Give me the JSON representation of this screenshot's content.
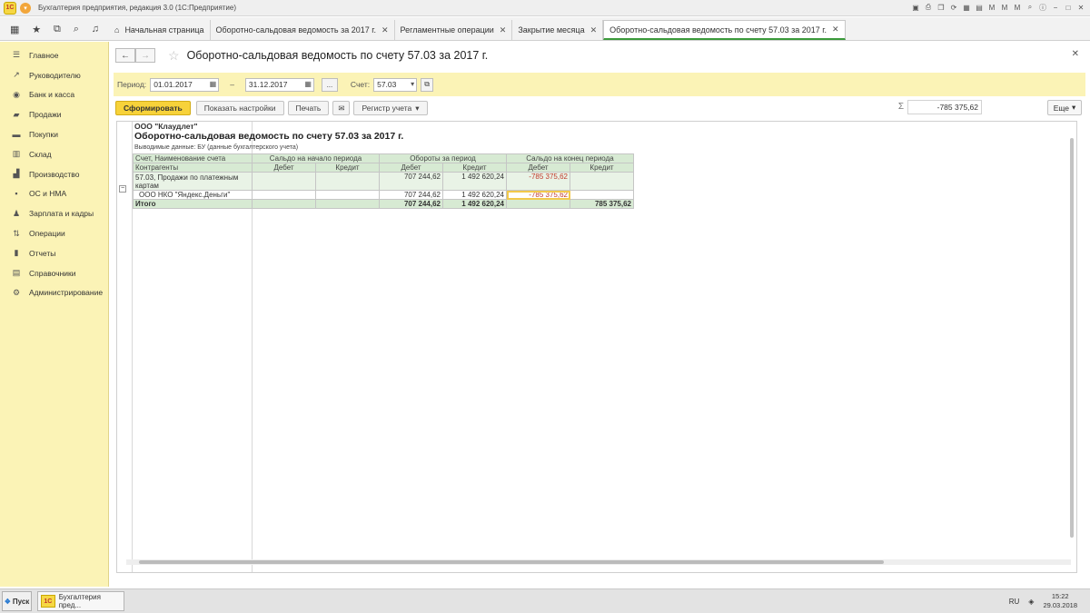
{
  "app": {
    "title": "Бухгалтерия предприятия, редакция 3.0 (1С:Предприятие)",
    "logo_text": "1С"
  },
  "tabs": [
    {
      "label": "Начальная страница",
      "closable": false
    },
    {
      "label": "Оборотно-сальдовая ведомость за 2017 г.",
      "closable": true
    },
    {
      "label": "Регламентные операции",
      "closable": true
    },
    {
      "label": "Закрытие месяца",
      "closable": true
    },
    {
      "label": "Оборотно-сальдовая ведомость по счету 57.03 за 2017 г.",
      "closable": true,
      "active": true
    }
  ],
  "sidebar": {
    "items": [
      {
        "label": "Главное",
        "icon": "list-icon"
      },
      {
        "label": "Руководителю",
        "icon": "trend-icon"
      },
      {
        "label": "Банк и касса",
        "icon": "bank-icon"
      },
      {
        "label": "Продажи",
        "icon": "cart-icon"
      },
      {
        "label": "Покупки",
        "icon": "truck-icon"
      },
      {
        "label": "Склад",
        "icon": "warehouse-icon"
      },
      {
        "label": "Производство",
        "icon": "factory-icon"
      },
      {
        "label": "ОС и НМА",
        "icon": "assets-icon"
      },
      {
        "label": "Зарплата и кадры",
        "icon": "people-icon"
      },
      {
        "label": "Операции",
        "icon": "operations-icon"
      },
      {
        "label": "Отчеты",
        "icon": "chart-icon"
      },
      {
        "label": "Справочники",
        "icon": "book-icon"
      },
      {
        "label": "Администрирование",
        "icon": "gear-icon"
      }
    ]
  },
  "form": {
    "title": "Оборотно-сальдовая ведомость по счету 57.03 за 2017 г.",
    "period_label": "Период:",
    "period_from": "01.01.2017",
    "period_dash": "–",
    "period_to": "31.12.2017",
    "ellipsis": "...",
    "account_label": "Счет:",
    "account_value": "57.03"
  },
  "commands": {
    "generate": "Сформировать",
    "show_settings": "Показать настройки",
    "print": "Печать",
    "register": "Регистр учета",
    "sigma": "Σ",
    "sum_value": "-785 375,62",
    "more": "Еще"
  },
  "report": {
    "org": "ООО \"Клаудлет\"",
    "title": "Оборотно-сальдовая ведомость по счету 57.03 за 2017 г.",
    "subtitle": "Выводимые данные:  БУ (данные бухгалтерского учета)",
    "headers": {
      "account": "Счет, Наименование счета",
      "counterparties": "Контрагенты",
      "opening": "Сальдо на начало периода",
      "turnover": "Обороты за период",
      "closing": "Сальдо на конец периода",
      "debit": "Дебет",
      "credit": "Кредит"
    },
    "rows": [
      {
        "name": "57.03, Продажи по платежным картам",
        "o_debit": "",
        "o_credit": "",
        "t_debit": "707 244,62",
        "t_credit": "1 492 620,24",
        "c_debit": "-785 375,62",
        "c_credit": ""
      },
      {
        "name": "ООО НКО \"Яндекс.Деньги\"",
        "o_debit": "",
        "o_credit": "",
        "t_debit": "707 244,62",
        "t_credit": "1 492 620,24",
        "c_debit": "-785 375,62",
        "c_credit": ""
      }
    ],
    "total": {
      "name": "Итого",
      "t_debit": "707 244,62",
      "t_credit": "1 492 620,24",
      "c_debit": "",
      "c_credit": "785 375,62"
    }
  },
  "taskbar": {
    "start": "Пуск",
    "app_item": "Бухгалтерия пред...",
    "lang": "RU",
    "time": "15:22",
    "date": "29.03.2018"
  },
  "colors": {
    "sidebar_bg": "#fbf3b6",
    "accent_yellow": "#f7d23a",
    "table_header_green": "#d7ead3",
    "negative_red": "#c0392b"
  }
}
